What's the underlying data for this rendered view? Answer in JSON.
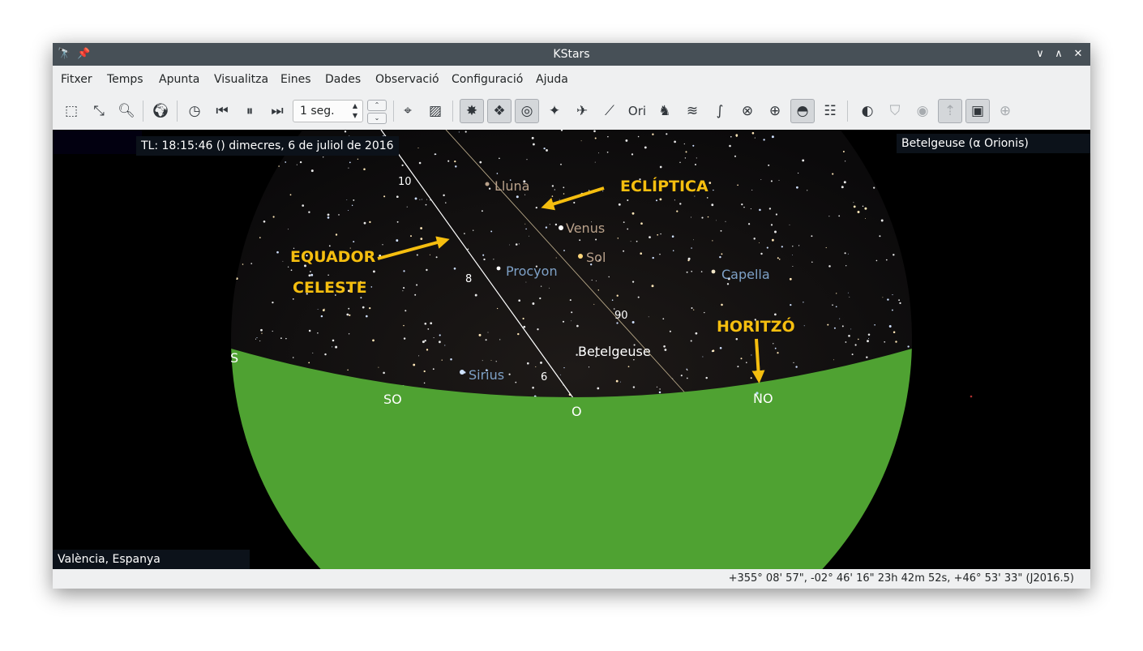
{
  "window": {
    "title": "KStars"
  },
  "menu": [
    "Fitxer",
    "Temps",
    "Apunta",
    "Visualitza",
    "Eines",
    "Dades",
    "Observació",
    "Configuració",
    "Ajuda"
  ],
  "toolbar": {
    "time_step": "1 seg."
  },
  "sky": {
    "time_info": "TL: 18:15:46 ()   dimecres, 6 de juliol de 2016",
    "focus_info": "Betelgeuse (α Orionis)",
    "location_info": "València, Espanya",
    "objects": {
      "lluna": "Lluna",
      "venus": "Venus",
      "sol": "Sol",
      "procyon": "Procyon",
      "capella": "Capella",
      "betelgeuse": "Betelgeuse",
      "sirius": "Sirius"
    },
    "compass": {
      "s": "S",
      "so": "SO",
      "o": "O",
      "no": "NO"
    },
    "equator_ticks": [
      "10",
      "8",
      "6"
    ],
    "ecliptic_tick": "90",
    "annotations": {
      "ecliptica": "ECLÍPTICA",
      "equador_1": "EQUADOR",
      "equador_2": "CELESTE",
      "horitzo": "HORITZÓ"
    },
    "colors": {
      "ground": "#4fa232",
      "annotation": "#f5be0f",
      "planet_label": "#b9a18a",
      "star_label": "#7ea1c7"
    }
  },
  "status": {
    "coordinates": "+355° 08' 57\", -02° 46' 16\"  23h 42m 52s, +46° 53' 33\" (J2016.5)"
  }
}
